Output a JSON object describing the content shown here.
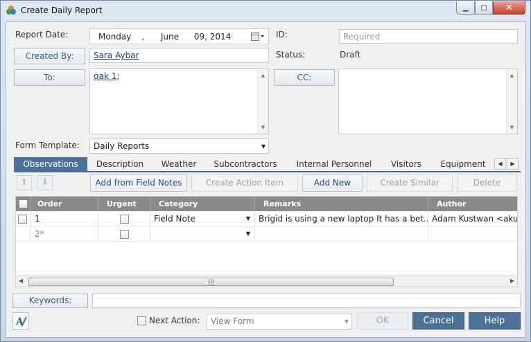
{
  "window": {
    "title": "Create Daily Report",
    "close_icon": "close-icon",
    "minimize_icon": "minimize-icon",
    "maximize_icon": "maximize-icon"
  },
  "form": {
    "report_date_label": "Report Date:",
    "report_date_day": "Monday",
    "report_date_sep": ",",
    "report_date_month": "June",
    "report_date_rest": "09, 2014",
    "id_label": "ID:",
    "id_placeholder": "Required",
    "created_by_label": "Created By:",
    "created_by_value": "Sara Aybar",
    "status_label": "Status:",
    "status_value": "Draft",
    "to_label": "To:",
    "to_value": "qak 1",
    "to_sep": ";",
    "cc_label": "CC:",
    "form_template_label": "Form Template:",
    "form_template_value": "Daily Reports"
  },
  "tabs": [
    {
      "label": "Observations",
      "active": true
    },
    {
      "label": "Description"
    },
    {
      "label": "Weather"
    },
    {
      "label": "Subcontractors"
    },
    {
      "label": "Internal Personnel"
    },
    {
      "label": "Visitors"
    },
    {
      "label": "Equipment"
    }
  ],
  "toolbar": {
    "add_from_field_notes": "Add from Field Notes",
    "create_action_item": "Create Action Item",
    "add_new": "Add New",
    "create_similar": "Create Similar",
    "delete": "Delete"
  },
  "grid": {
    "columns": [
      "Order",
      "Urgent",
      "Category",
      "Remarks",
      "Author"
    ],
    "rows": [
      {
        "order": "1",
        "urgent": false,
        "category": "Field Note",
        "remarks": "Brigid is using a new laptop It has a bet...",
        "author": "Adam Kustwan <akust"
      },
      {
        "order": "2*",
        "urgent": false,
        "category": "",
        "remarks": "",
        "author": ""
      }
    ]
  },
  "bottom": {
    "keywords_label": "Keywords:",
    "keywords_value": "",
    "next_action_label": "Next Action:",
    "next_action_value": "View Form",
    "ok": "OK",
    "cancel": "Cancel",
    "help": "Help"
  },
  "colors": {
    "accent": "#4d7097",
    "header_grey": "#8a8a8a",
    "link": "#1a3a6a"
  }
}
